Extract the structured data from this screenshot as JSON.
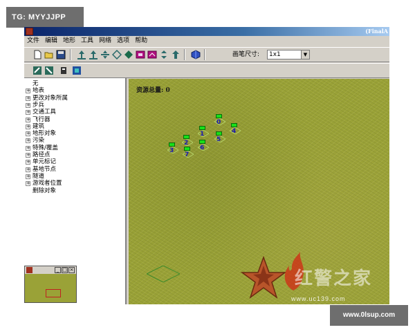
{
  "watermarks": {
    "top_left": "TG: MYYJJPP",
    "bottom_right": "www.0lsup.com"
  },
  "window": {
    "title": "(FinalA"
  },
  "menu": {
    "items": [
      "文件",
      "编辑",
      "地形",
      "工具",
      "网络",
      "选项",
      "帮助"
    ]
  },
  "toolbar": {
    "brush_label": "画笔尺寸:",
    "brush_value": "1x1"
  },
  "tree": {
    "items": [
      {
        "label": "无",
        "expandable": false
      },
      {
        "label": "地表",
        "expandable": true
      },
      {
        "label": "更改对象所属",
        "expandable": true
      },
      {
        "label": "步兵",
        "expandable": true
      },
      {
        "label": "交通工具",
        "expandable": true
      },
      {
        "label": "飞行器",
        "expandable": true
      },
      {
        "label": "建筑",
        "expandable": true
      },
      {
        "label": "地形对象",
        "expandable": true
      },
      {
        "label": "污染",
        "expandable": true
      },
      {
        "label": "特殊/覆盖",
        "expandable": true
      },
      {
        "label": "路径点",
        "expandable": true
      },
      {
        "label": "单元标记",
        "expandable": true
      },
      {
        "label": "基地节点",
        "expandable": true
      },
      {
        "label": "隧道",
        "expandable": true
      },
      {
        "label": "游戏者位置",
        "expandable": true
      },
      {
        "label": "删除对象",
        "expandable": false
      }
    ]
  },
  "map": {
    "resource_label": "资源总量: 0",
    "waypoints": [
      "0",
      "1",
      "2",
      "3",
      "4",
      "5",
      "6",
      "7"
    ]
  },
  "logo": {
    "text": "红警之家",
    "url": "www.uc139.com"
  },
  "colors": {
    "title_bar": "#0a246a",
    "terrain": "#9aa237",
    "waypoint_flag": "#18e018",
    "waypoint_number": "#1c1cb0"
  }
}
